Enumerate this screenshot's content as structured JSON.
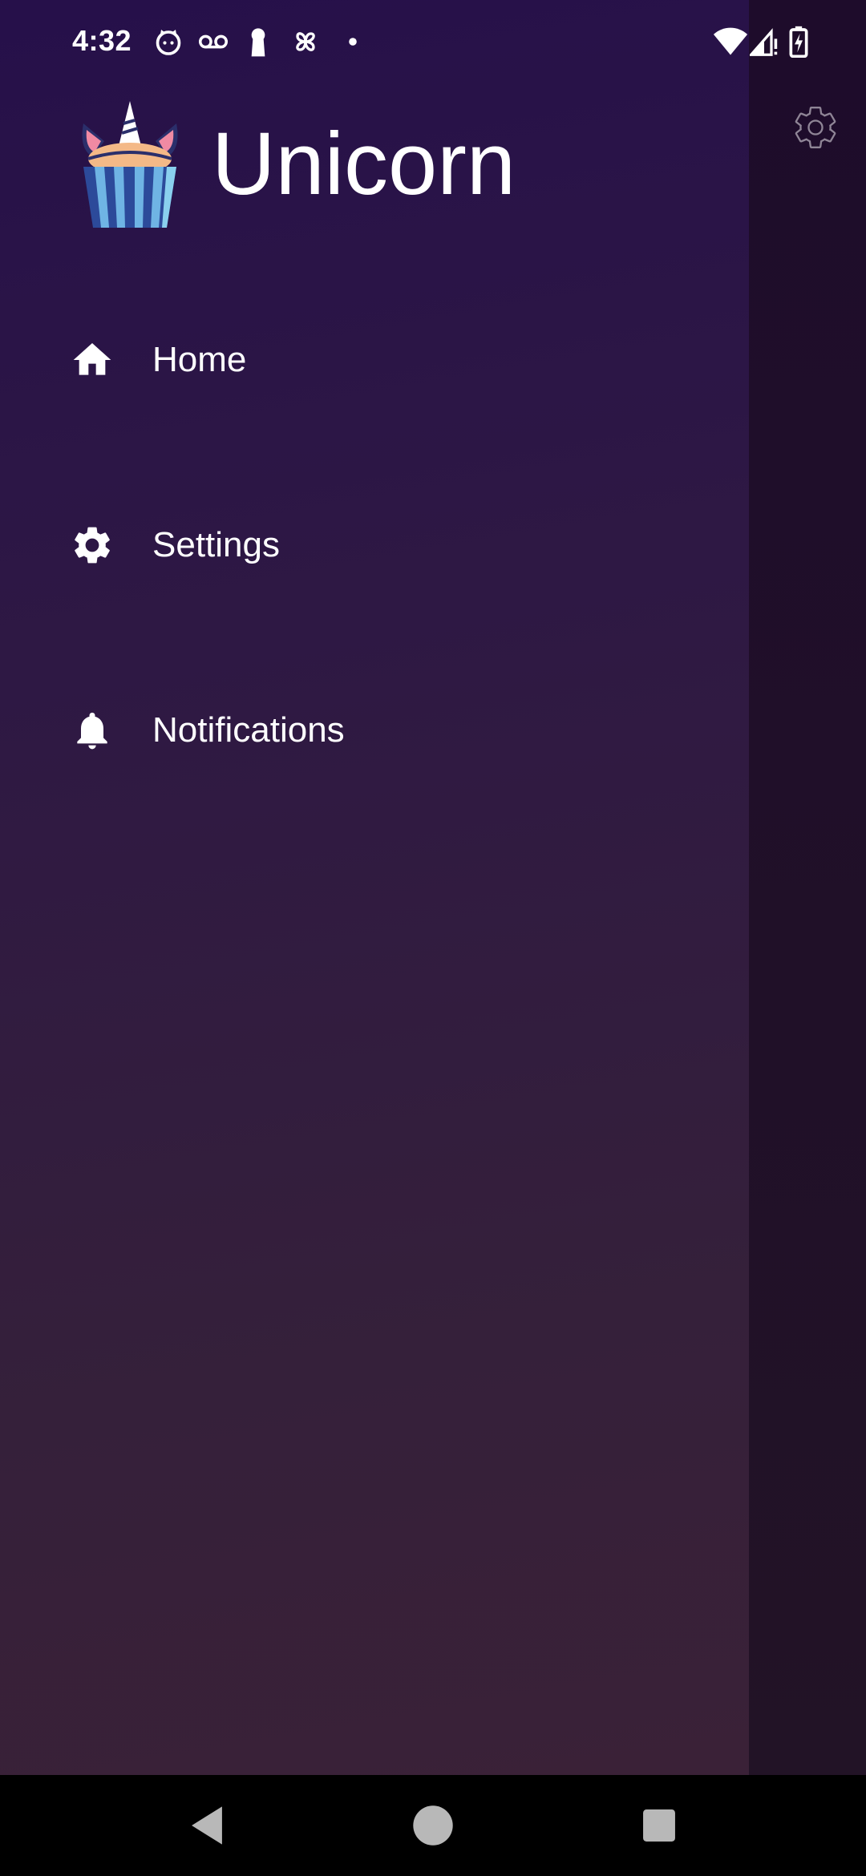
{
  "status_bar": {
    "time": "4:32",
    "left_icons": [
      "cat-face-icon",
      "voicemail-icon",
      "keyhole-icon",
      "pinwheel-icon",
      "dot-icon"
    ],
    "right_icons": [
      "wifi-icon",
      "cell-signal-icon",
      "battery-charging-icon"
    ]
  },
  "drawer": {
    "app_title": "Unicorn",
    "logo_icon": "unicorn-cupcake-logo",
    "items": [
      {
        "label": "Home",
        "icon": "home-icon"
      },
      {
        "label": "Settings",
        "icon": "gear-icon"
      },
      {
        "label": "Notifications",
        "icon": "bell-icon"
      }
    ]
  },
  "background_app": {
    "settings_icon": "gear-outline-icon"
  },
  "nav_bar": {
    "buttons": [
      "back-icon",
      "home-circle-icon",
      "recents-icon"
    ]
  },
  "colors": {
    "drawer_top": "#26104a",
    "drawer_bottom": "#3a2137",
    "text": "#ffffff",
    "nav_bar": "#000000"
  }
}
